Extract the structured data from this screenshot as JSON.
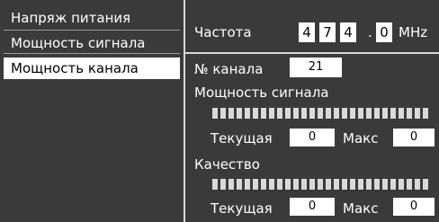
{
  "menu": {
    "items": [
      {
        "label": "Напряж питания"
      },
      {
        "label": "Мощность сигнала"
      },
      {
        "label": "Мощность канала"
      }
    ]
  },
  "frequency": {
    "label": "Частота",
    "digits": [
      "4",
      "7",
      "4",
      "0"
    ],
    "separator": ".",
    "unit": "MHz"
  },
  "channel": {
    "label": "№ канала",
    "value": "21"
  },
  "signal_power": {
    "label": "Мощность сигнала",
    "level_fraction": 1.0,
    "current_label": "Текущая",
    "current_value": "0",
    "max_label": "Макс",
    "max_value": "0"
  },
  "quality": {
    "label": "Качество",
    "level_fraction": 1.0,
    "current_label": "Текущая",
    "current_value": "0",
    "max_label": "Макс",
    "max_value": "0"
  },
  "colors": {
    "background": "#3a3a3a",
    "highlight": "#ffffff",
    "bar": "#d9d9d9"
  }
}
